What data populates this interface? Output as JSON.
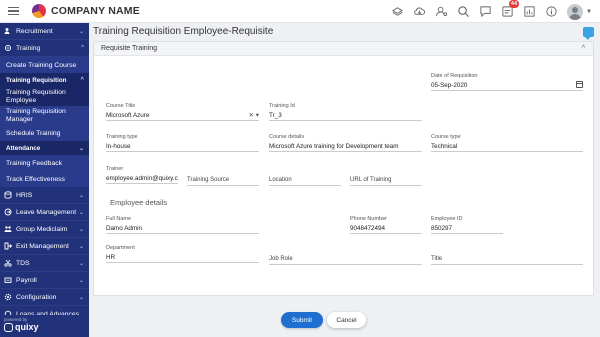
{
  "app": {
    "brand": "COMPANY NAME"
  },
  "topbar": {
    "notification_count": "44"
  },
  "sidebar": {
    "recruitment": "Recruitment",
    "training": "Training",
    "create_training_course": "Create Training Course",
    "training_requisition": "Training Requisition",
    "tr_employee": "Training Requisition Employee",
    "tr_manager": "Training Requisition Manager",
    "schedule_training": "Schedule Training",
    "attendance": "Attendance",
    "training_feedback": "Training Feedback",
    "track_effectiveness": "Track Effectiveness",
    "hris": "HRIS",
    "leave_management": "Leave Management",
    "group_mediclaim": "Group Mediclaim",
    "exit_management": "Exit Management",
    "tds": "TDS",
    "payroll": "Payroll",
    "configuration": "Configuration",
    "loans": "Loans and Advances",
    "powered_by": "powered by",
    "quixy": "quixy"
  },
  "page": {
    "title": "Training Requisition Employee-Requisite"
  },
  "card": {
    "title": "Requisite Training"
  },
  "form": {
    "date_of_requisition": {
      "label": "Date of Requisition",
      "value": "05-Sep-2020"
    },
    "course_title": {
      "label": "Course Title",
      "value": "Microsoft Azure"
    },
    "training_id": {
      "label": "Training Id",
      "value": "Tr_3"
    },
    "training_type": {
      "label": "Training type",
      "value": "In-house"
    },
    "course_details": {
      "label": "Course details",
      "value": "Microsoft Azure training for Development team"
    },
    "course_type": {
      "label": "Course type",
      "value": "Technical"
    },
    "trainer": {
      "label": "Trainer",
      "value": "employee.admin@quixy.c..."
    },
    "training_source": {
      "label": "Training Source",
      "value": ""
    },
    "location": {
      "label": "Location",
      "value": ""
    },
    "url_of_training": {
      "label": "URL of Training",
      "value": ""
    },
    "employee_details_title": "Employee details",
    "full_name": {
      "label": "Full Name",
      "value": "Damo Admin"
    },
    "phone_number": {
      "label": "Phone Number",
      "value": "9048472494"
    },
    "employee_id": {
      "label": "Employee ID",
      "value": "850297"
    },
    "department": {
      "label": "Department",
      "value": "HR"
    },
    "job_role": {
      "label": "Job Role",
      "value": ""
    },
    "title": {
      "label": "Title",
      "value": ""
    }
  },
  "buttons": {
    "submit": "Submit",
    "cancel": "Cancel"
  },
  "colors": {
    "sidebar": "#21317a",
    "primary": "#1f6fd1",
    "badge": "#e53935"
  }
}
